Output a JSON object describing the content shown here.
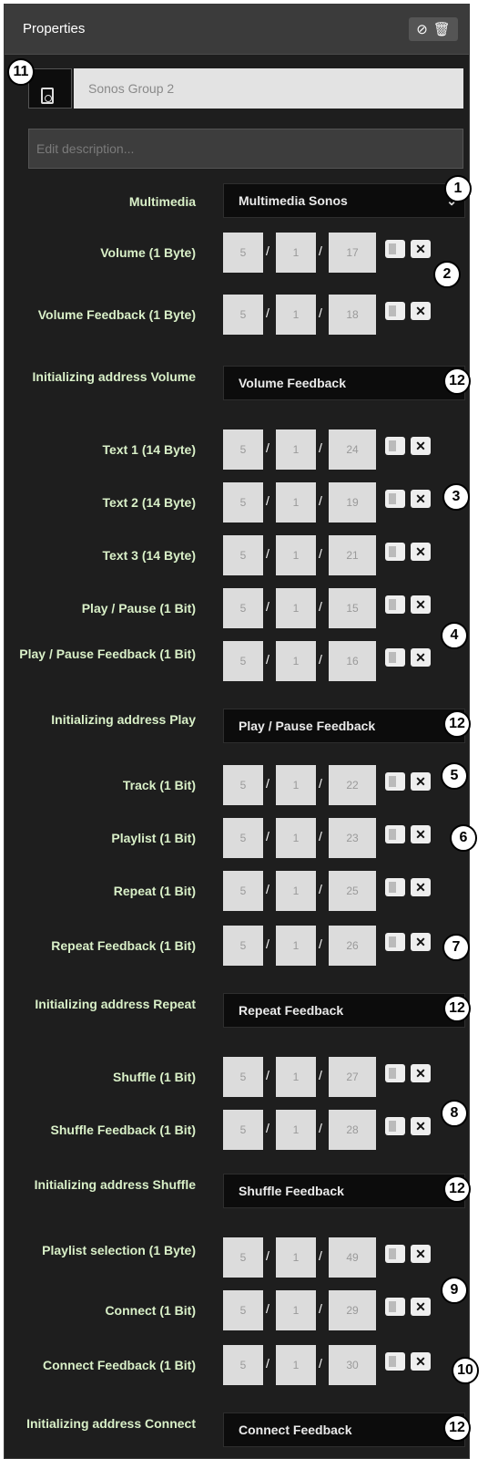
{
  "header": {
    "title": "Properties",
    "icons": [
      "no-entry-icon",
      "trash-icon"
    ]
  },
  "name_field": {
    "value": "Sonos Group 2"
  },
  "description": {
    "placeholder": "Edit description..."
  },
  "multimedia": {
    "label": "Multimedia",
    "value": "Multimedia Sonos",
    "callout": "1"
  },
  "rows": [
    {
      "label": "Volume (1 Byte)",
      "a": "5",
      "b": "1",
      "c": "17"
    },
    {
      "label": "Volume Feedback (1 Byte)",
      "a": "5",
      "b": "1",
      "c": "18"
    },
    {
      "label": "Initializing address Volume",
      "select": "Volume Feedback"
    },
    {
      "label": "Text 1 (14 Byte)",
      "a": "5",
      "b": "1",
      "c": "24"
    },
    {
      "label": "Text 2 (14 Byte)",
      "a": "5",
      "b": "1",
      "c": "19"
    },
    {
      "label": "Text 3 (14 Byte)",
      "a": "5",
      "b": "1",
      "c": "21"
    },
    {
      "label": "Play / Pause (1 Bit)",
      "a": "5",
      "b": "1",
      "c": "15"
    },
    {
      "label": "Play / Pause Feedback (1 Bit)",
      "a": "5",
      "b": "1",
      "c": "16"
    },
    {
      "label": "Initializing address Play",
      "select": "Play / Pause Feedback"
    },
    {
      "label": "Track (1 Bit)",
      "a": "5",
      "b": "1",
      "c": "22"
    },
    {
      "label": "Playlist (1 Bit)",
      "a": "5",
      "b": "1",
      "c": "23"
    },
    {
      "label": "Repeat (1 Bit)",
      "a": "5",
      "b": "1",
      "c": "25"
    },
    {
      "label": "Repeat Feedback (1 Bit)",
      "a": "5",
      "b": "1",
      "c": "26"
    },
    {
      "label": "Initializing address Repeat",
      "select": "Repeat Feedback"
    },
    {
      "label": "Shuffle (1 Bit)",
      "a": "5",
      "b": "1",
      "c": "27"
    },
    {
      "label": "Shuffle Feedback (1 Bit)",
      "a": "5",
      "b": "1",
      "c": "28"
    },
    {
      "label": "Initializing address Shuffle",
      "select": "Shuffle Feedback"
    },
    {
      "label": "Playlist selection (1 Byte)",
      "a": "5",
      "b": "1",
      "c": "49"
    },
    {
      "label": "Connect (1 Bit)",
      "a": "5",
      "b": "1",
      "c": "29"
    },
    {
      "label": "Connect Feedback (1 Bit)",
      "a": "5",
      "b": "1",
      "c": "30"
    },
    {
      "label": "Initializing address Connect",
      "select": "Connect Feedback"
    }
  ],
  "callouts": {
    "c11": "11",
    "c1": "1",
    "c2": "2",
    "c3": "3",
    "c4": "4",
    "c5": "5",
    "c6": "6",
    "c7": "7",
    "c8": "8",
    "c9": "9",
    "c10": "10",
    "c12": "12"
  }
}
